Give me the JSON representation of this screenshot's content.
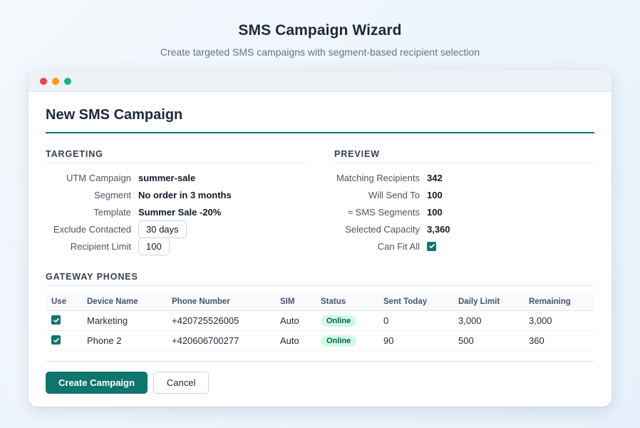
{
  "page": {
    "title": "SMS Campaign Wizard",
    "subtitle": "Create targeted SMS campaigns with segment-based recipient selection"
  },
  "window": {
    "dot_colors": [
      "#ef4444",
      "#f59e0b",
      "#10b981"
    ]
  },
  "form": {
    "title": "New SMS Campaign"
  },
  "targeting": {
    "heading": "TARGETING",
    "utm_label": "UTM Campaign",
    "utm_value": "summer-sale",
    "segment_label": "Segment",
    "segment_value": "No order in 3 months",
    "template_label": "Template",
    "template_value": "Summer Sale -20%",
    "exclude_label": "Exclude Contacted",
    "exclude_value": "30 days",
    "limit_label": "Recipient Limit",
    "limit_value": "100"
  },
  "preview": {
    "heading": "PREVIEW",
    "matching_label": "Matching Recipients",
    "matching_value": "342",
    "willsend_label": "Will Send To",
    "willsend_value": "100",
    "segments_label": "≈ SMS Segments",
    "segments_value": "100",
    "capacity_label": "Selected Capacity",
    "capacity_value": "3,360",
    "canfit_label": "Can Fit All",
    "canfit_checked": true
  },
  "gateway": {
    "heading": "GATEWAY PHONES",
    "columns": [
      "Use",
      "Device Name",
      "Phone Number",
      "SIM",
      "Status",
      "Sent Today",
      "Daily Limit",
      "Remaining"
    ],
    "rows": [
      {
        "use": true,
        "device": "Marketing",
        "phone": "+420725526005",
        "sim": "Auto",
        "status": "Online",
        "sent": "0",
        "limit": "3,000",
        "remaining": "3,000"
      },
      {
        "use": true,
        "device": "Phone 2",
        "phone": "+420606700277",
        "sim": "Auto",
        "status": "Online",
        "sent": "90",
        "limit": "500",
        "remaining": "360"
      }
    ]
  },
  "actions": {
    "create_label": "Create Campaign",
    "cancel_label": "Cancel"
  },
  "colors": {
    "accent": "#0f766e",
    "status_online_bg": "#d1fae5",
    "status_online_text": "#065f46"
  }
}
